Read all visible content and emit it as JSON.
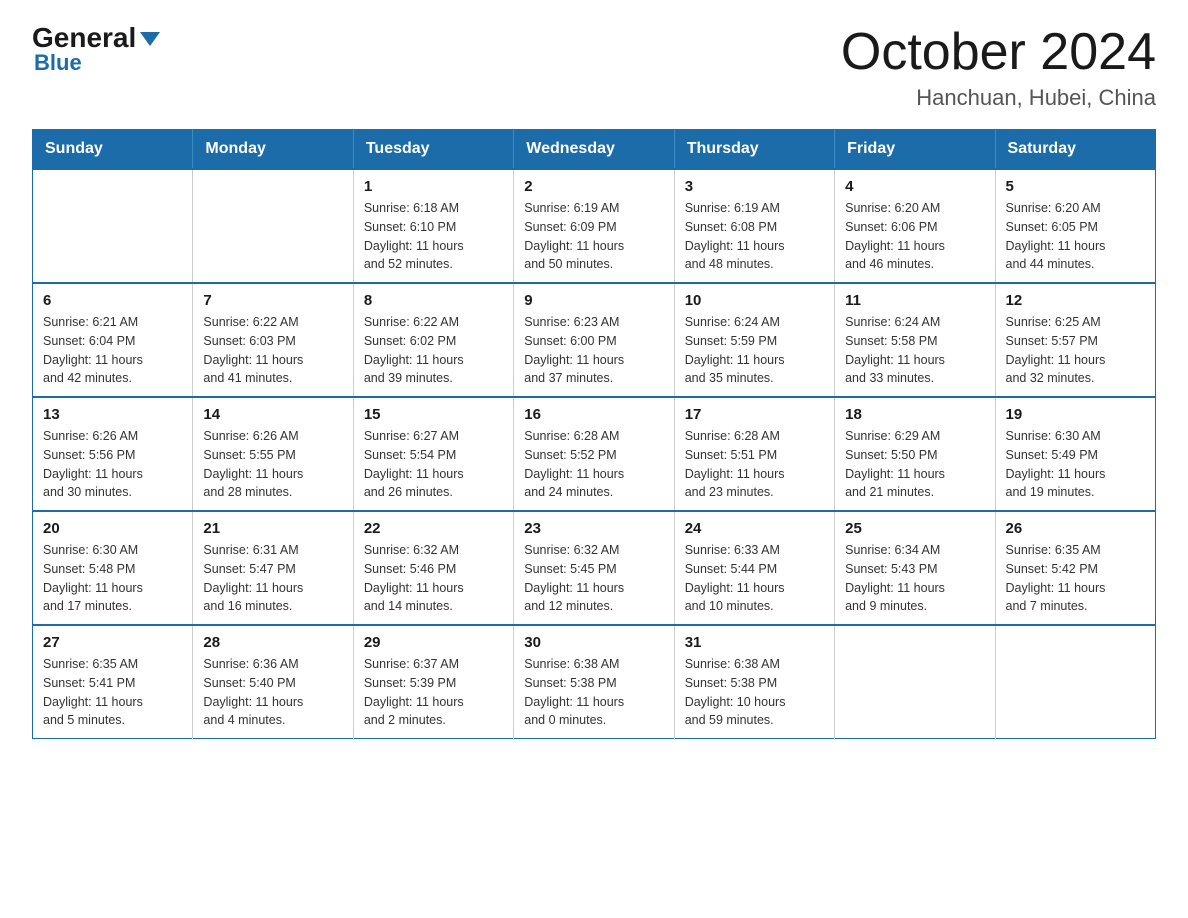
{
  "header": {
    "logo_general": "General",
    "logo_blue": "Blue",
    "title": "October 2024",
    "subtitle": "Hanchuan, Hubei, China"
  },
  "calendar": {
    "days_of_week": [
      "Sunday",
      "Monday",
      "Tuesday",
      "Wednesday",
      "Thursday",
      "Friday",
      "Saturday"
    ],
    "weeks": [
      [
        {
          "day": "",
          "info": ""
        },
        {
          "day": "",
          "info": ""
        },
        {
          "day": "1",
          "info": "Sunrise: 6:18 AM\nSunset: 6:10 PM\nDaylight: 11 hours\nand 52 minutes."
        },
        {
          "day": "2",
          "info": "Sunrise: 6:19 AM\nSunset: 6:09 PM\nDaylight: 11 hours\nand 50 minutes."
        },
        {
          "day": "3",
          "info": "Sunrise: 6:19 AM\nSunset: 6:08 PM\nDaylight: 11 hours\nand 48 minutes."
        },
        {
          "day": "4",
          "info": "Sunrise: 6:20 AM\nSunset: 6:06 PM\nDaylight: 11 hours\nand 46 minutes."
        },
        {
          "day": "5",
          "info": "Sunrise: 6:20 AM\nSunset: 6:05 PM\nDaylight: 11 hours\nand 44 minutes."
        }
      ],
      [
        {
          "day": "6",
          "info": "Sunrise: 6:21 AM\nSunset: 6:04 PM\nDaylight: 11 hours\nand 42 minutes."
        },
        {
          "day": "7",
          "info": "Sunrise: 6:22 AM\nSunset: 6:03 PM\nDaylight: 11 hours\nand 41 minutes."
        },
        {
          "day": "8",
          "info": "Sunrise: 6:22 AM\nSunset: 6:02 PM\nDaylight: 11 hours\nand 39 minutes."
        },
        {
          "day": "9",
          "info": "Sunrise: 6:23 AM\nSunset: 6:00 PM\nDaylight: 11 hours\nand 37 minutes."
        },
        {
          "day": "10",
          "info": "Sunrise: 6:24 AM\nSunset: 5:59 PM\nDaylight: 11 hours\nand 35 minutes."
        },
        {
          "day": "11",
          "info": "Sunrise: 6:24 AM\nSunset: 5:58 PM\nDaylight: 11 hours\nand 33 minutes."
        },
        {
          "day": "12",
          "info": "Sunrise: 6:25 AM\nSunset: 5:57 PM\nDaylight: 11 hours\nand 32 minutes."
        }
      ],
      [
        {
          "day": "13",
          "info": "Sunrise: 6:26 AM\nSunset: 5:56 PM\nDaylight: 11 hours\nand 30 minutes."
        },
        {
          "day": "14",
          "info": "Sunrise: 6:26 AM\nSunset: 5:55 PM\nDaylight: 11 hours\nand 28 minutes."
        },
        {
          "day": "15",
          "info": "Sunrise: 6:27 AM\nSunset: 5:54 PM\nDaylight: 11 hours\nand 26 minutes."
        },
        {
          "day": "16",
          "info": "Sunrise: 6:28 AM\nSunset: 5:52 PM\nDaylight: 11 hours\nand 24 minutes."
        },
        {
          "day": "17",
          "info": "Sunrise: 6:28 AM\nSunset: 5:51 PM\nDaylight: 11 hours\nand 23 minutes."
        },
        {
          "day": "18",
          "info": "Sunrise: 6:29 AM\nSunset: 5:50 PM\nDaylight: 11 hours\nand 21 minutes."
        },
        {
          "day": "19",
          "info": "Sunrise: 6:30 AM\nSunset: 5:49 PM\nDaylight: 11 hours\nand 19 minutes."
        }
      ],
      [
        {
          "day": "20",
          "info": "Sunrise: 6:30 AM\nSunset: 5:48 PM\nDaylight: 11 hours\nand 17 minutes."
        },
        {
          "day": "21",
          "info": "Sunrise: 6:31 AM\nSunset: 5:47 PM\nDaylight: 11 hours\nand 16 minutes."
        },
        {
          "day": "22",
          "info": "Sunrise: 6:32 AM\nSunset: 5:46 PM\nDaylight: 11 hours\nand 14 minutes."
        },
        {
          "day": "23",
          "info": "Sunrise: 6:32 AM\nSunset: 5:45 PM\nDaylight: 11 hours\nand 12 minutes."
        },
        {
          "day": "24",
          "info": "Sunrise: 6:33 AM\nSunset: 5:44 PM\nDaylight: 11 hours\nand 10 minutes."
        },
        {
          "day": "25",
          "info": "Sunrise: 6:34 AM\nSunset: 5:43 PM\nDaylight: 11 hours\nand 9 minutes."
        },
        {
          "day": "26",
          "info": "Sunrise: 6:35 AM\nSunset: 5:42 PM\nDaylight: 11 hours\nand 7 minutes."
        }
      ],
      [
        {
          "day": "27",
          "info": "Sunrise: 6:35 AM\nSunset: 5:41 PM\nDaylight: 11 hours\nand 5 minutes."
        },
        {
          "day": "28",
          "info": "Sunrise: 6:36 AM\nSunset: 5:40 PM\nDaylight: 11 hours\nand 4 minutes."
        },
        {
          "day": "29",
          "info": "Sunrise: 6:37 AM\nSunset: 5:39 PM\nDaylight: 11 hours\nand 2 minutes."
        },
        {
          "day": "30",
          "info": "Sunrise: 6:38 AM\nSunset: 5:38 PM\nDaylight: 11 hours\nand 0 minutes."
        },
        {
          "day": "31",
          "info": "Sunrise: 6:38 AM\nSunset: 5:38 PM\nDaylight: 10 hours\nand 59 minutes."
        },
        {
          "day": "",
          "info": ""
        },
        {
          "day": "",
          "info": ""
        }
      ]
    ]
  }
}
